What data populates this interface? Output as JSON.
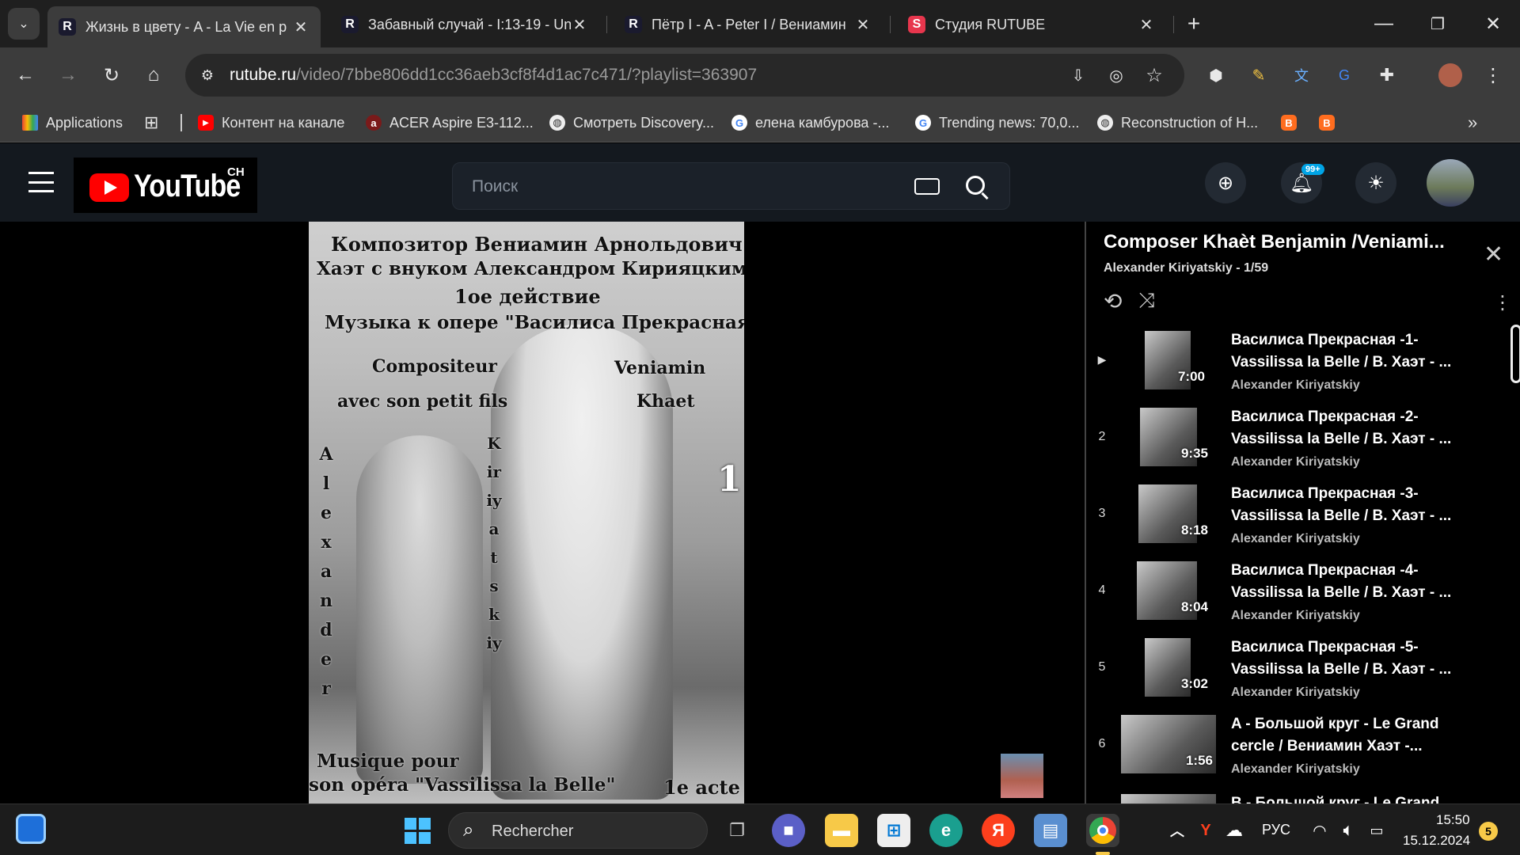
{
  "tabs": [
    {
      "title": "Жизнь в цвету - A - La Vie en p",
      "active": true
    },
    {
      "title": "Забавный случай - I:13-19 - Un",
      "active": false
    },
    {
      "title": "Пётр I - A - Peter I / Вениамин",
      "active": false
    },
    {
      "title": "Студия RUTUBE",
      "active": false
    }
  ],
  "omnibox": {
    "domain": "rutube.ru",
    "path": "/video/7bbe806dd1cc36aeb3cf8f4d1ac7c471/?playlist=363907"
  },
  "bookmarks": [
    {
      "label": "Applications",
      "icon": "apps-grid-icon"
    },
    {
      "label": "Контент на канале",
      "icon": "youtube-icon"
    },
    {
      "label": "ACER Aspire E3-112...",
      "icon": "acer-icon"
    },
    {
      "label": "Смотреть Discovery...",
      "icon": "globe-icon"
    },
    {
      "label": "елена камбурова -...",
      "icon": "google-icon"
    },
    {
      "label": "Trending news: 70,0...",
      "icon": "google-icon"
    },
    {
      "label": "Reconstruction of H...",
      "icon": "globe-icon"
    }
  ],
  "header": {
    "logo_text": "YouTube",
    "logo_badge": "CH",
    "search_placeholder": "Поиск",
    "notif_badge": "99+"
  },
  "video_overlay": {
    "line1": "Композитор Вениамин Арнольдович",
    "line2": "Хаэт с внуком Александром Кирияцким",
    "line3": "1ое действие",
    "line4": "Музыка к опере \"Василиса Прекрасная\"",
    "left_fr": "Compositeur",
    "left_fr2": "avec son petit fils",
    "right_fr": "Veniamin",
    "right_fr2": "Khaet",
    "vertical_left": "Alexander",
    "vertical_right": "Kiriyatskiy",
    "number": "1",
    "bottom1": "Musique pour",
    "bottom2": "son opéra \"Vassilissa la Belle\"",
    "bottom_right": "1e acte"
  },
  "playlist": {
    "title": "Composer Khaèt Benjamin /Veniami...",
    "meta": "Alexander Kiriyatskiy - 1/59",
    "items": [
      {
        "index": "▶",
        "title": "Василиса Прекрасная -1- Vassilissa la Belle / В. Хаэт - ...",
        "duration": "7:00",
        "channel": "Alexander Kiriyatskiy"
      },
      {
        "index": "2",
        "title": "Василиса Прекрасная -2- Vassilissa la Belle / В. Хаэт - ...",
        "duration": "9:35",
        "channel": "Alexander Kiriyatskiy"
      },
      {
        "index": "3",
        "title": "Василиса Прекрасная -3- Vassilissa la Belle / В. Хаэт - ...",
        "duration": "8:18",
        "channel": "Alexander Kiriyatskiy"
      },
      {
        "index": "4",
        "title": "Василиса Прекрасная -4- Vassilissa la Belle / В. Хаэт - ...",
        "duration": "8:04",
        "channel": "Alexander Kiriyatskiy"
      },
      {
        "index": "5",
        "title": "Василиса Прекрасная -5- Vassilissa la Belle / В. Хаэт - ...",
        "duration": "3:02",
        "channel": "Alexander Kiriyatskiy"
      },
      {
        "index": "6",
        "title": "A - Большой круг - Le Grand cercle / Вениамин Хаэт -...",
        "duration": "1:56",
        "channel": "Alexander Kiriyatskiy"
      },
      {
        "index": "",
        "title": "B - Большой круг - Le Grand",
        "duration": "",
        "channel": ""
      }
    ]
  },
  "taskbar": {
    "search_placeholder": "Rechercher",
    "lang": "РУС",
    "time": "15:50",
    "date": "15.12.2024",
    "notif_count": "5"
  }
}
